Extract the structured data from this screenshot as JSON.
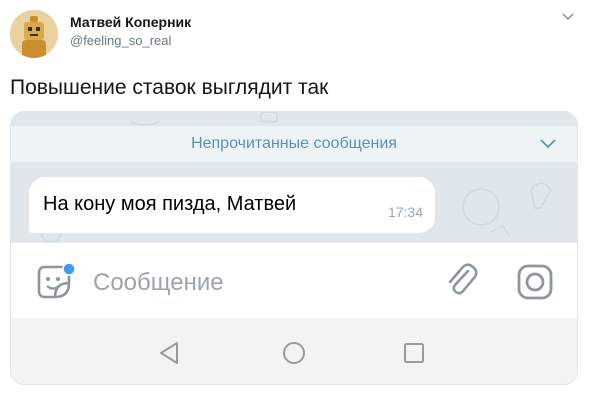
{
  "tweet": {
    "author_name": "Матвей Коперник",
    "author_handle": "@feeling_so_real",
    "text": "Повышение ставок выглядит так"
  },
  "chat": {
    "unread_label": "Непрочитанные сообщения",
    "message_text": "На кону моя пизда, Матвей",
    "message_time": "17:34",
    "input_placeholder": "Сообщение"
  },
  "icons": {
    "avatar": "avatar-image",
    "more": "chevron-down-icon",
    "sticker": "sticker-icon",
    "attach": "paperclip-icon",
    "camera": "camera-icon",
    "back": "back-triangle-icon",
    "home": "home-circle-icon",
    "recent": "recent-square-icon"
  },
  "colors": {
    "accent": "#5b8fb8",
    "badge": "#3d9be9",
    "chat_background": "#dfe7ec"
  }
}
